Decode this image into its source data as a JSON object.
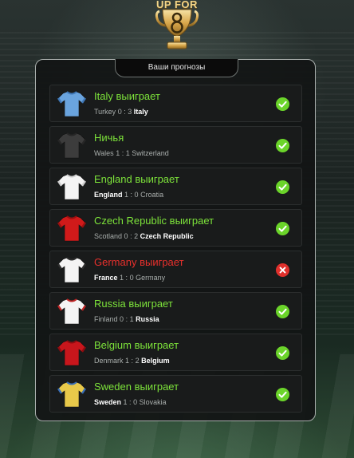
{
  "brand": {
    "logo_text": "UP FOR"
  },
  "panel": {
    "title": "Ваши прогнозы"
  },
  "colors": {
    "win": "#7de33a",
    "loss": "#e8302c",
    "check": "#6bd42a",
    "cross": "#e0302c"
  },
  "predictions": [
    {
      "title": "Italy выиграет",
      "home": "Turkey",
      "home_score": "0",
      "away": "Italy",
      "away_score": "3",
      "winner": "away",
      "status": "correct",
      "jersey_icon": "jersey-icon",
      "jersey_color": "#6aa4de",
      "jersey_trim": "#3f78b8"
    },
    {
      "title": "Ничья",
      "home": "Wales",
      "home_score": "1",
      "away": "Switzerland",
      "away_score": "1",
      "winner": "none",
      "status": "correct",
      "jersey_icon": "jersey-icon",
      "jersey_color": "#3c3c3c",
      "jersey_trim": "#262626"
    },
    {
      "title": "England выиграет",
      "home": "England",
      "home_score": "1",
      "away": "Croatia",
      "away_score": "0",
      "winner": "home",
      "status": "correct",
      "jersey_icon": "jersey-icon",
      "jersey_color": "#f4f4f4",
      "jersey_trim": "#cfcfcf"
    },
    {
      "title": "Czech Republic выиграет",
      "home": "Scotland",
      "home_score": "0",
      "away": "Czech Republic",
      "away_score": "2",
      "winner": "away",
      "status": "correct",
      "jersey_icon": "jersey-icon",
      "jersey_color": "#d11a1a",
      "jersey_trim": "#9b0f0f"
    },
    {
      "title": "Germany выиграет",
      "home": "France",
      "home_score": "1",
      "away": "Germany",
      "away_score": "0",
      "winner": "home",
      "status": "wrong",
      "jersey_icon": "jersey-icon",
      "jersey_color": "#f4f4f4",
      "jersey_trim": "#2d2d2d"
    },
    {
      "title": "Russia выиграет",
      "home": "Finland",
      "home_score": "0",
      "away": "Russia",
      "away_score": "1",
      "winner": "away",
      "status": "correct",
      "jersey_icon": "jersey-icon",
      "jersey_color": "#f4f4f4",
      "jersey_trim": "#c02424"
    },
    {
      "title": "Belgium выиграет",
      "home": "Denmark",
      "home_score": "1",
      "away": "Belgium",
      "away_score": "2",
      "winner": "away",
      "status": "correct",
      "jersey_icon": "jersey-icon",
      "jersey_color": "#c8161c",
      "jersey_trim": "#8e0c10"
    },
    {
      "title": "Sweden выиграет",
      "home": "Sweden",
      "home_score": "1",
      "away": "Slovakia",
      "away_score": "0",
      "winner": "home",
      "status": "correct",
      "jersey_icon": "jersey-icon",
      "jersey_color": "#e8c94a",
      "jersey_trim": "#3a6fb8"
    }
  ]
}
